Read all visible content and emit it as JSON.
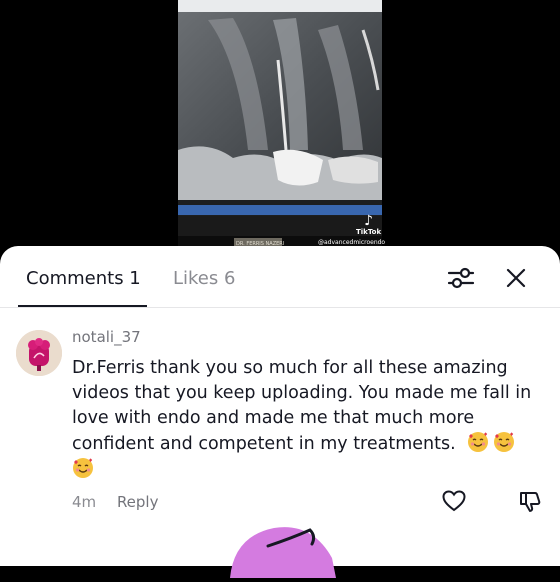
{
  "video": {
    "overlay_label": "DR. FERRIS NAZERI",
    "watermark": {
      "brand": "TikTok",
      "handle": "@advancedmicroendo"
    }
  },
  "tabs": [
    {
      "label": "Comments 1",
      "active": true
    },
    {
      "label": "Likes 6",
      "active": false
    }
  ],
  "icons": {
    "filter": "sliders-icon",
    "close": "close-icon",
    "like": "heart-outline-icon",
    "dislike": "thumbs-down-icon"
  },
  "comment": {
    "username": "notali_37",
    "text": "Dr.Ferris thank you so much for all these amazing videos that you keep uploading. You made me fall in love with endo and made me that much more confident and competent in my treatments.",
    "emoji": "🥰",
    "time": "4m",
    "reply_label": "Reply"
  },
  "colors": {
    "text_primary": "#161823",
    "text_secondary": "#8a8b91",
    "sticker": "#d47be0"
  }
}
